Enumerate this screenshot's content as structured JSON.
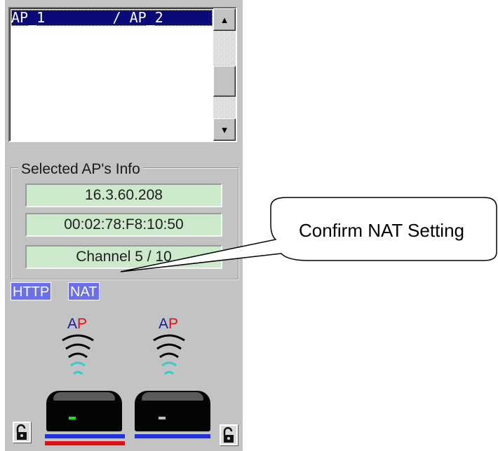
{
  "ap_list": {
    "selected_item": "AP_1        / AP_2"
  },
  "selected_info": {
    "group_label": "Selected AP's Info",
    "ip_address": "16.3.60.208",
    "mac_address": "00:02:78:F8:10:50",
    "channel": "Channel 5 / 10"
  },
  "tags": {
    "http": "HTTP",
    "nat": "NAT"
  },
  "access_points": [
    {
      "letter_a": "A",
      "letter_p": "P",
      "led_color": "#22dd22"
    },
    {
      "letter_a": "A",
      "letter_p": "P",
      "led_color": "#bbbbbb"
    }
  ],
  "callout": {
    "text": "Confirm NAT Setting"
  },
  "colors": {
    "selection": "#0a0a78",
    "info_field": "#cce9cc",
    "tag": "#6a6ef0",
    "wave_outer": "#000000",
    "wave_inner": "#33cccc",
    "base_blue": "#2233dd",
    "base_red": "#e01010"
  }
}
